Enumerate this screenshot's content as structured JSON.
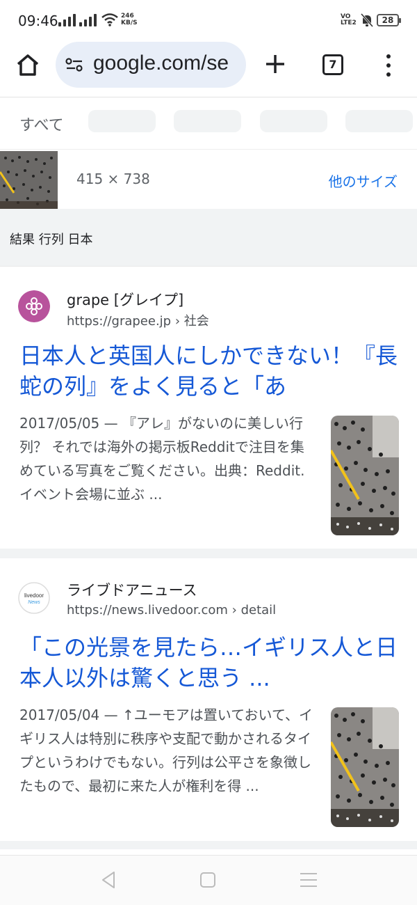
{
  "status": {
    "time": "09:46",
    "net_speed_value": "246",
    "net_speed_unit": "KB/S",
    "volte_top": "VO",
    "volte_bottom": "LTE2",
    "battery": "28"
  },
  "toolbar": {
    "url": "google.com/se",
    "tab_count": "7"
  },
  "filters": {
    "all_label": "すべて"
  },
  "image_info": {
    "dimensions": "415 × 738",
    "other_sizes": "他のサイズ"
  },
  "query": "結果 行列 日本",
  "results": [
    {
      "site_name": "grape [グレイプ]",
      "url": "https://grapee.jp",
      "crumb": " › 社会",
      "title": "日本人と英国人にしかできない！『長蛇の列』をよく見ると「あ",
      "snippet": "2017/05/05 — 『アレ』がないのに美しい行列？ それでは海外の掲示板Redditで注目を集めている写真をご覧ください。出典：Reddit. イベント会場に並ぶ ...",
      "logo_color": "#b8539c"
    },
    {
      "site_name": "ライブドアニュース",
      "url": "https://news.livedoor.com",
      "crumb": " › detail",
      "title": "「この光景を見たら…イギリス人と日本人以外は驚くと思う ...",
      "snippet": "2017/05/04 — ↑ユーモアは置いておいて、イギリス人は特別に秩序や支配で動かされるタイプというわけでもない。行列は公平さを象徴したもので、最初に来た人が権利を得 ...",
      "logo_text_top": "livedoor",
      "logo_text_bottom": "News"
    }
  ]
}
